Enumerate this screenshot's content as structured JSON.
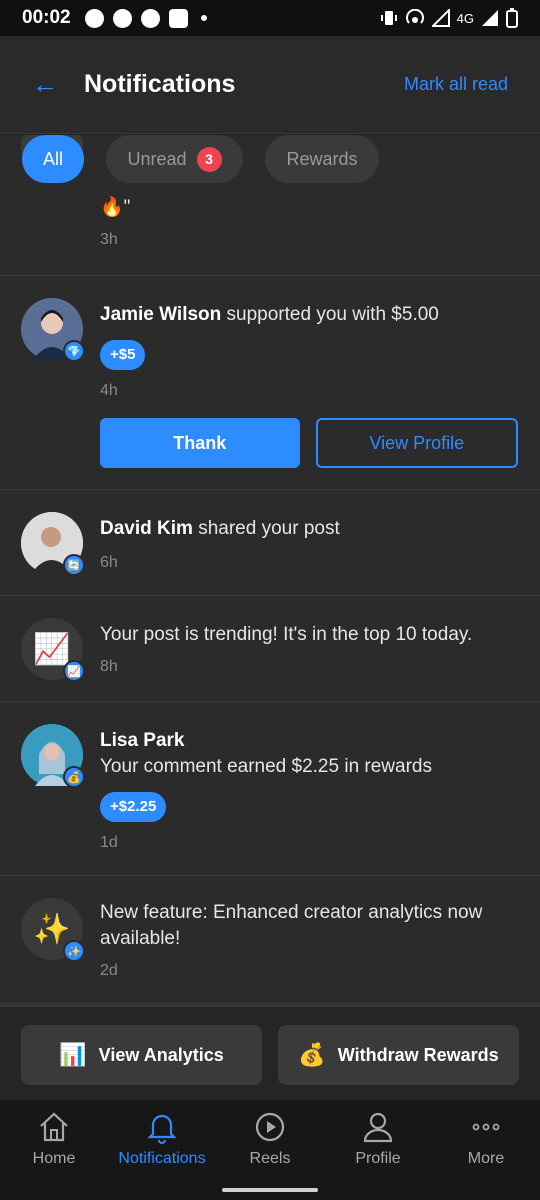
{
  "status_bar": {
    "time": "00:02",
    "network": "4G"
  },
  "header": {
    "back_icon": "←",
    "title": "Notifications",
    "mark_all": "Mark all read"
  },
  "tabs": [
    {
      "label": "All",
      "active": true
    },
    {
      "label": "Unread",
      "badge": "3"
    },
    {
      "label": "Rewards"
    }
  ],
  "notifications": [
    {
      "tail_text": "🔥\"",
      "time": "3h"
    },
    {
      "actor": "Jamie Wilson",
      "text": " supported you with $5.00",
      "amount": "+$5",
      "time": "4h",
      "overlay_icon": "💎",
      "primary_btn": "Thank",
      "secondary_btn": "View Profile"
    },
    {
      "actor": "David Kim",
      "text": " shared your post",
      "time": "6h",
      "overlay_icon": "🔄"
    },
    {
      "text": "Your post is trending! It's in the top 10 today.",
      "time": "8h",
      "icon": "📈",
      "overlay_icon": "📈"
    },
    {
      "actor": "Lisa Park",
      "text": "Your comment earned $2.25 in rewards",
      "amount": "+$2.25",
      "time": "1d",
      "overlay_icon": "💰"
    },
    {
      "text": "New feature: Enhanced creator analytics now available!",
      "time": "2d",
      "icon": "✨",
      "overlay_icon": "✨"
    }
  ],
  "actions": [
    {
      "label": "View Analytics",
      "icon": "📊"
    },
    {
      "label": "Withdraw Rewards",
      "icon": "💰"
    }
  ],
  "bottom_nav": [
    {
      "label": "Home",
      "icon": "home-icon"
    },
    {
      "label": "Notifications",
      "icon": "bell-icon",
      "active": true
    },
    {
      "label": "Reels",
      "icon": "play-icon"
    },
    {
      "label": "Profile",
      "icon": "user-icon"
    },
    {
      "label": "More",
      "icon": "more-icon"
    }
  ],
  "colors": {
    "accent": "#2d8cff",
    "badge": "#f0424f",
    "background": "#2b2b2b"
  }
}
